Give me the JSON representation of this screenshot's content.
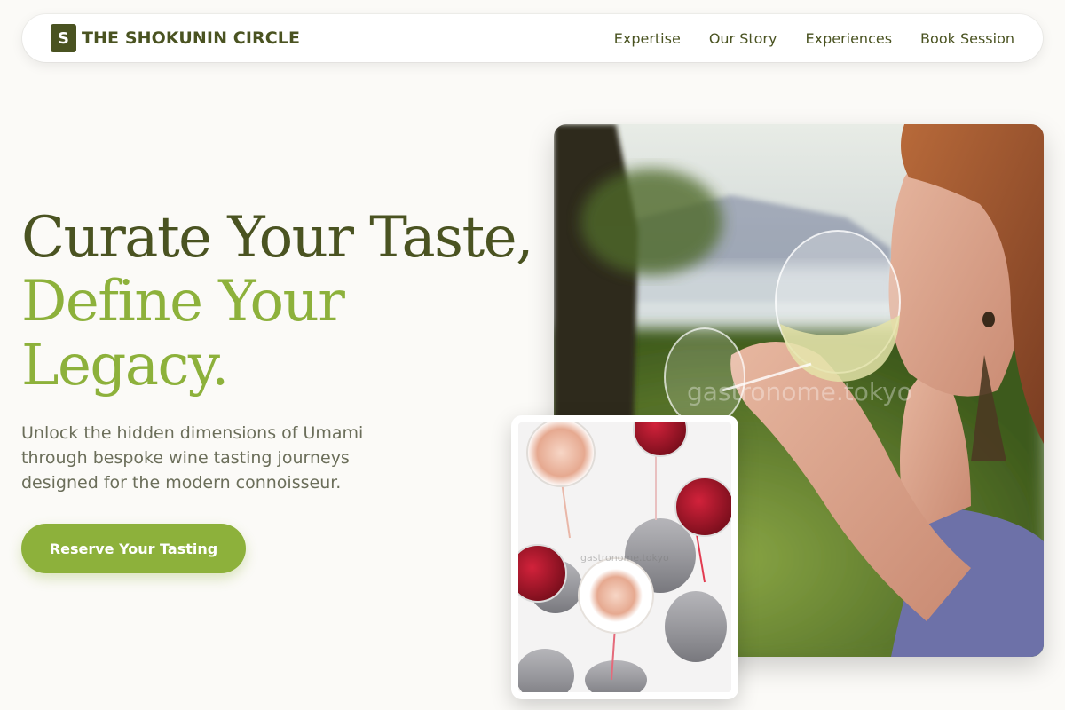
{
  "brand": {
    "mark": "S",
    "name": "THE SHOKUNIN CIRCLE"
  },
  "nav": {
    "links": [
      "Expertise",
      "Our Story",
      "Experiences",
      "Book Session"
    ]
  },
  "hero": {
    "headline_line1": "Curate Your Taste,",
    "headline_line2": "Define Your",
    "headline_line3": "Legacy.",
    "subtext": "Unlock the hidden dimensions of Umami through bespoke wine tasting journeys designed for the modern connoisseur.",
    "cta_label": "Reserve Your Tasting"
  },
  "images": {
    "main_watermark": "gastronome.tokyo",
    "card_watermark": "gastronome.tokyo"
  },
  "colors": {
    "dark_olive": "#4a5321",
    "accent_green": "#8db13b",
    "background": "#fbfaf7"
  }
}
